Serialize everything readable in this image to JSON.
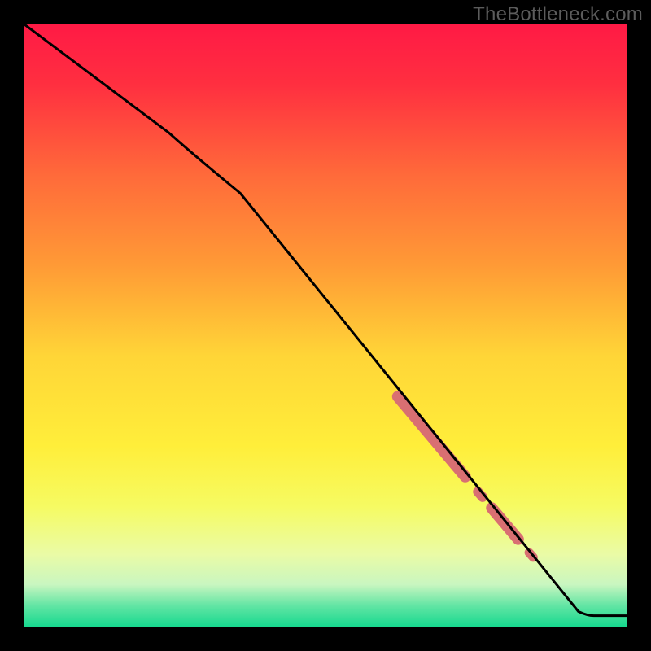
{
  "watermark": "TheBottleneck.com",
  "chart_data": {
    "type": "line",
    "title": "",
    "xlabel": "",
    "ylabel": "",
    "xlim": [
      0,
      100
    ],
    "ylim": [
      0,
      100
    ],
    "gradient_stops": [
      {
        "offset": 0.0,
        "color": "#ff1a45"
      },
      {
        "offset": 0.1,
        "color": "#ff2f40"
      },
      {
        "offset": 0.25,
        "color": "#ff6a3a"
      },
      {
        "offset": 0.4,
        "color": "#ff9a36"
      },
      {
        "offset": 0.55,
        "color": "#ffd537"
      },
      {
        "offset": 0.7,
        "color": "#ffee3a"
      },
      {
        "offset": 0.8,
        "color": "#f6fb62"
      },
      {
        "offset": 0.88,
        "color": "#eafba6"
      },
      {
        "offset": 0.93,
        "color": "#c9f6c0"
      },
      {
        "offset": 0.965,
        "color": "#63e5a4"
      },
      {
        "offset": 1.0,
        "color": "#17d98f"
      }
    ],
    "curve_points": [
      {
        "x": 0.0,
        "y": 100.0
      },
      {
        "x": 24.0,
        "y": 82.0
      },
      {
        "x": 28.5,
        "y": 78.0
      },
      {
        "x": 92.0,
        "y": 2.5
      },
      {
        "x": 93.5,
        "y": 1.8
      },
      {
        "x": 100.0,
        "y": 1.8
      }
    ],
    "highlight_segments": [
      {
        "x1": 62.0,
        "y1": 38.2,
        "x2": 73.2,
        "y2": 24.9,
        "width": 14
      },
      {
        "x1": 75.3,
        "y1": 22.4,
        "x2": 76.1,
        "y2": 21.5,
        "width": 12
      },
      {
        "x1": 77.6,
        "y1": 19.7,
        "x2": 82.0,
        "y2": 14.5,
        "width": 14
      },
      {
        "x1": 83.8,
        "y1": 12.3,
        "x2": 84.5,
        "y2": 11.5,
        "width": 11
      }
    ],
    "highlight_color": "#d96f72",
    "curve_color": "#000000",
    "curve_width": 3
  }
}
